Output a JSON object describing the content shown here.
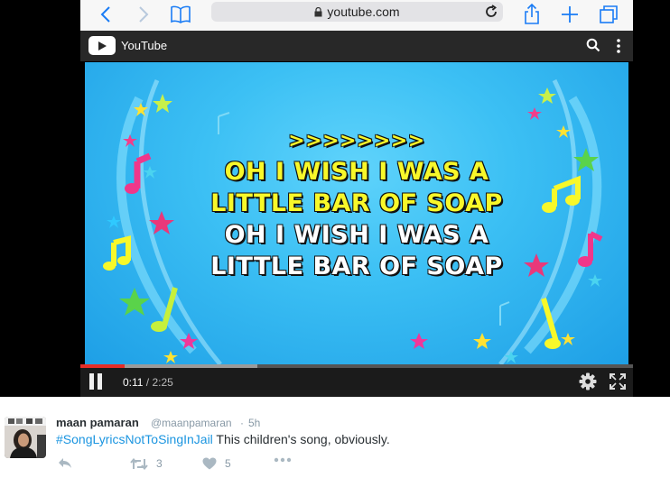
{
  "browser": {
    "url": "youtube.com"
  },
  "youtube": {
    "brand": "YouTube"
  },
  "video": {
    "lyrics": {
      "arrows": ">>>>>>>>",
      "line1": "OH I WISH I WAS A",
      "line2": "LITTLE BAR OF SOAP",
      "line3": "OH I WISH I WAS A",
      "line4": "LITTLE BAR OF SOAP"
    },
    "current_time": "0:11",
    "separator": " / ",
    "duration": "2:25",
    "progress_fraction": 0.08,
    "buffered_fraction": 0.32
  },
  "tweet": {
    "author_name": "maan pamaran",
    "author_handle": "@maanpamaran",
    "dot": "·",
    "time": "5h",
    "hashtag": "#SongLyricsNotToSingInJail",
    "text": " This children's song, obviously.",
    "retweet_count": "3",
    "like_count": "5"
  },
  "colors": {
    "accent_blue": "#1a7cf5",
    "yt_red": "#e52d27",
    "lyric_yellow": "#f8f82a",
    "hashtag_blue": "#1b95e0"
  },
  "icons": [
    "chevron-left-icon",
    "chevron-right-icon",
    "book-icon",
    "lock-icon",
    "reload-icon",
    "share-icon",
    "plus-icon",
    "tabs-icon",
    "youtube-play-icon",
    "search-icon",
    "more-vertical-icon",
    "pause-icon",
    "gear-icon",
    "fullscreen-icon",
    "reply-icon",
    "retweet-icon",
    "heart-icon",
    "more-horizontal-icon"
  ]
}
